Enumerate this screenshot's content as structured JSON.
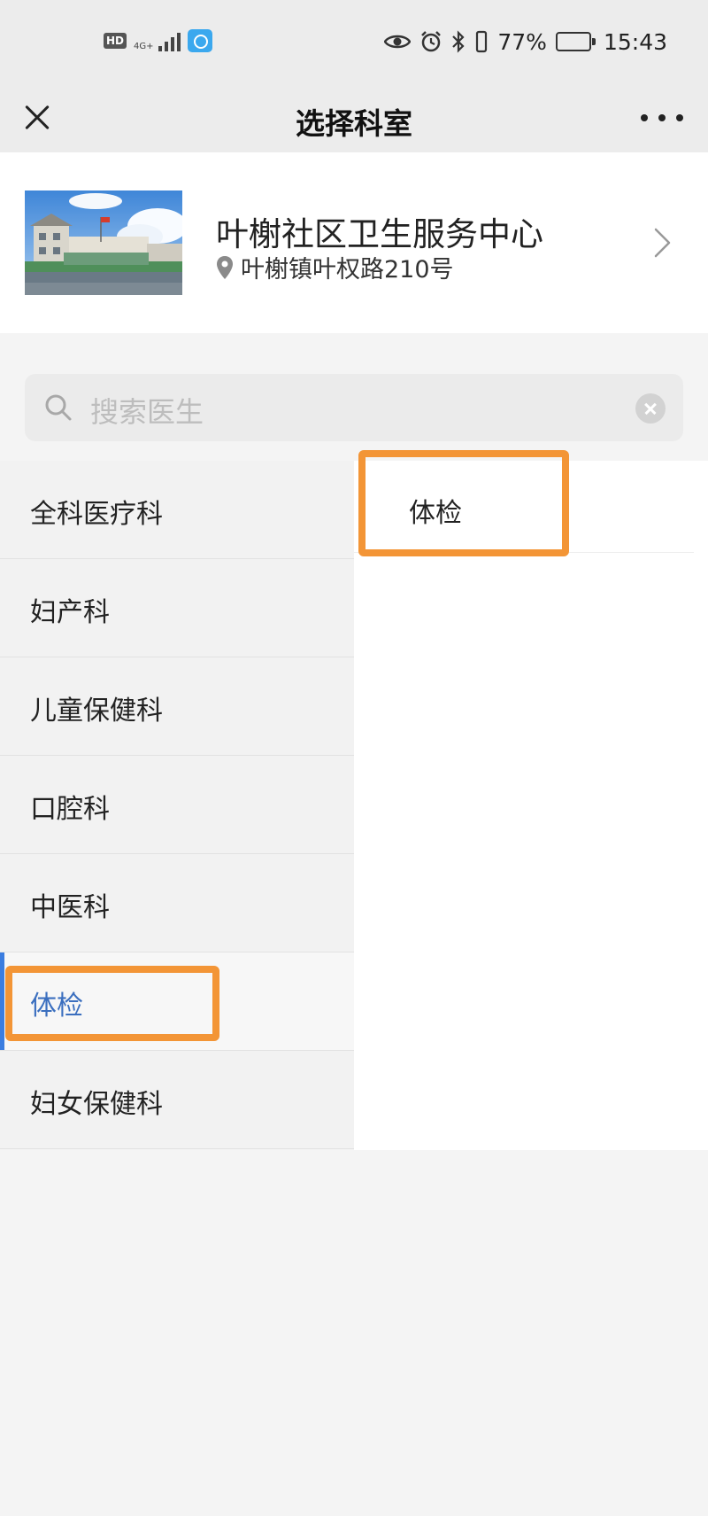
{
  "status_bar": {
    "hd_label": "HD",
    "network": "4G+",
    "battery_percent": "77%",
    "battery_level": 0.77,
    "time": "15:43"
  },
  "nav": {
    "title": "选择科室",
    "close_icon": "close-icon",
    "more_icon": "more-icon"
  },
  "hospital": {
    "name": "叶榭社区卫生服务中心",
    "address": "叶榭镇叶权路210号"
  },
  "search": {
    "placeholder": "搜索医生"
  },
  "departments": [
    {
      "label": "全科医疗科",
      "active": false
    },
    {
      "label": "妇产科",
      "active": false
    },
    {
      "label": "儿童保健科",
      "active": false
    },
    {
      "label": "口腔科",
      "active": false
    },
    {
      "label": "中医科",
      "active": false
    },
    {
      "label": "体检",
      "active": true
    },
    {
      "label": "妇女保健科",
      "active": false
    }
  ],
  "sub_departments": [
    {
      "label": "体检"
    }
  ],
  "colors": {
    "accent_blue": "#3b7de0",
    "highlight_orange": "#f39536"
  }
}
